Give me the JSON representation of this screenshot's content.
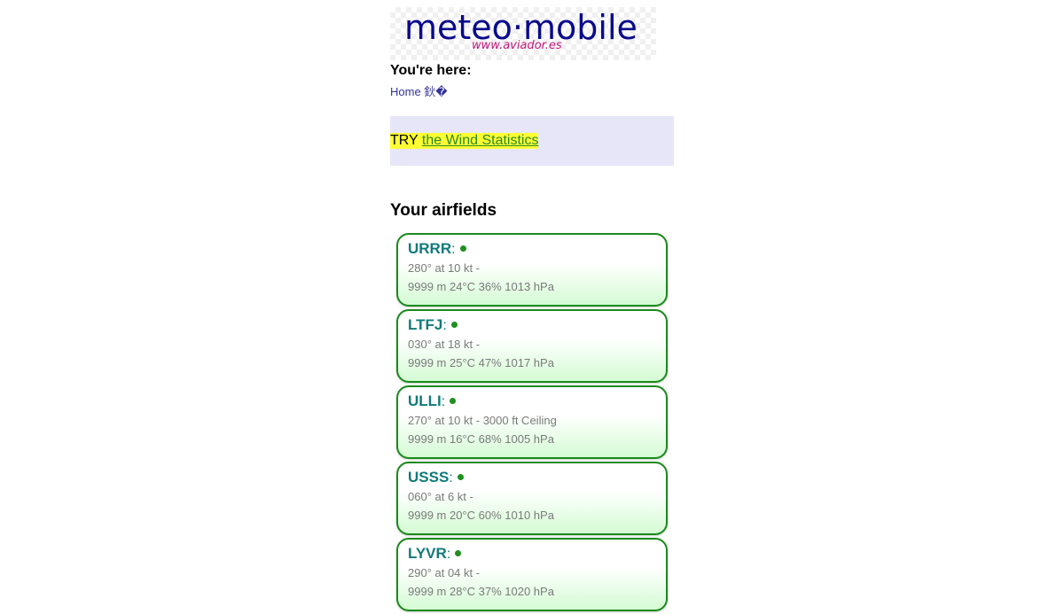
{
  "logo": {
    "title": "meteo·mobile",
    "subtitle": "www.aviador.es"
  },
  "location": {
    "title": "You're here:",
    "breadcrumb": "Home 鈥�"
  },
  "promo": {
    "prefix": "TRY ",
    "link_text": "the Wind Statistics",
    "highlight_color": "#ffff33",
    "background_color": "#e6e6f8"
  },
  "airfields_title": "Your airfields",
  "status_color": "#1f8f1f",
  "airfields": [
    {
      "code": "URRR",
      "colon": ":",
      "wind": "280° at 10 kt -",
      "weather": "9999 m 24°C 36% 1013 hPa"
    },
    {
      "code": "LTFJ",
      "colon": ":",
      "wind": "030° at 18 kt -",
      "weather": "9999 m 25°C 47% 1017 hPa"
    },
    {
      "code": "ULLI",
      "colon": ":",
      "wind": "270° at 10 kt - 3000 ft Ceiling",
      "weather": "9999 m 16°C 68% 1005 hPa"
    },
    {
      "code": "USSS",
      "colon": ":",
      "wind": "060° at 6 kt -",
      "weather": "9999 m 20°C 60% 1010 hPa"
    },
    {
      "code": "LYVR",
      "colon": ":",
      "wind": "290° at 04 kt -",
      "weather": "9999 m 28°C 37% 1020 hPa"
    }
  ]
}
